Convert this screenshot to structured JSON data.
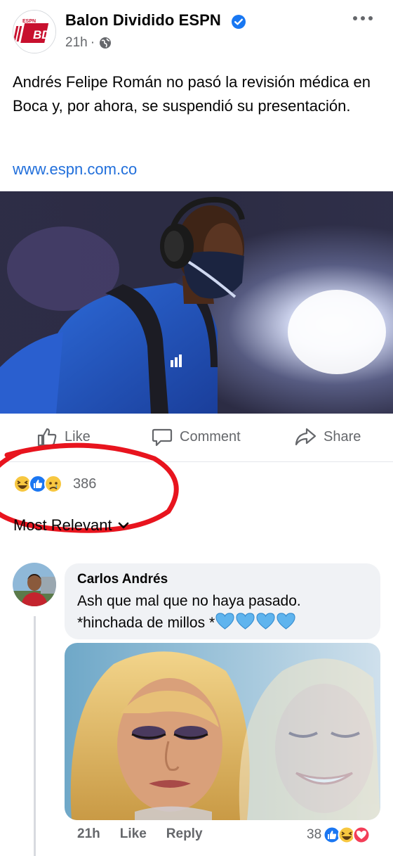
{
  "post": {
    "page_name": "Balon Dividido ESPN",
    "page_logo_text": "BD",
    "page_logo_small": "ESPN",
    "time": "21h",
    "separator": "·",
    "text": "Andrés Felipe Román no pasó la revisión médica en Boca y, por ahora, se suspendió su presentación.",
    "link": "www.espn.com.co"
  },
  "actions": {
    "like": "Like",
    "comment": "Comment",
    "share": "Share"
  },
  "reactions": {
    "icons": [
      "haha-icon",
      "like-icon",
      "sad-icon"
    ],
    "count": "386"
  },
  "sort": {
    "label": "Most Relevant"
  },
  "comment": {
    "author": "Carlos Andrés",
    "line1": "Ash que mal que no haya pasado.",
    "line2": "*hinchada de millos *",
    "hearts": [
      "blue-heart-icon",
      "blue-heart-icon",
      "blue-heart-icon",
      "blue-heart-icon"
    ],
    "time": "21h",
    "like": "Like",
    "reply": "Reply",
    "reaction_count": "38",
    "reaction_icons": [
      "like-icon",
      "haha-icon",
      "love-icon"
    ]
  },
  "colors": {
    "link": "#216fdb",
    "secondary_text": "#65676b",
    "annotation_red": "#e8141e",
    "bubble": "#f0f2f5"
  }
}
